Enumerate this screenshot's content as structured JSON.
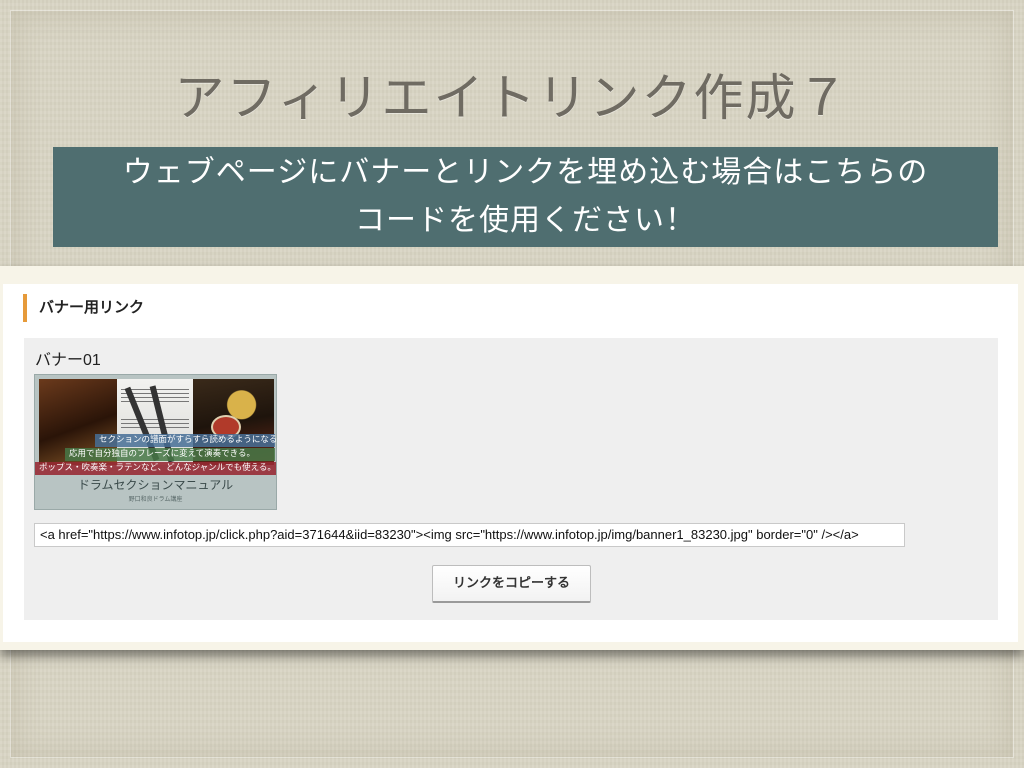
{
  "slide": {
    "title": "アフィリエイトリンク作成７",
    "instruction_line1": "ウェブページにバナーとリンクを埋め込む場合はこちらの",
    "instruction_line2": "コードを使用ください！"
  },
  "panel": {
    "section_heading": "バナー用リンク",
    "banner_label": "バナー01",
    "banner_image": {
      "line1": "セクションの譜面がすらすら読めるようになる。",
      "line2": "応用で自分独自のフレーズに変えて演奏できる。",
      "line3": "ポップス・吹奏楽・ラテンなど、どんなジャンルでも使える。",
      "title": "ドラムセクションマニュアル",
      "subtitle": "野口和良ドラム講座"
    },
    "code_value": "<a href=\"https://www.infotop.jp/click.php?aid=371644&iid=83230\"><img src=\"https://www.infotop.jp/img/banner1_83230.jpg\" border=\"0\" /></a>",
    "copy_button_label": "リンクをコピーする"
  },
  "colors": {
    "instruction_bg": "#4f6e70",
    "accent_bar": "#e69a3a",
    "slide_bg": "#d9d5c4"
  }
}
